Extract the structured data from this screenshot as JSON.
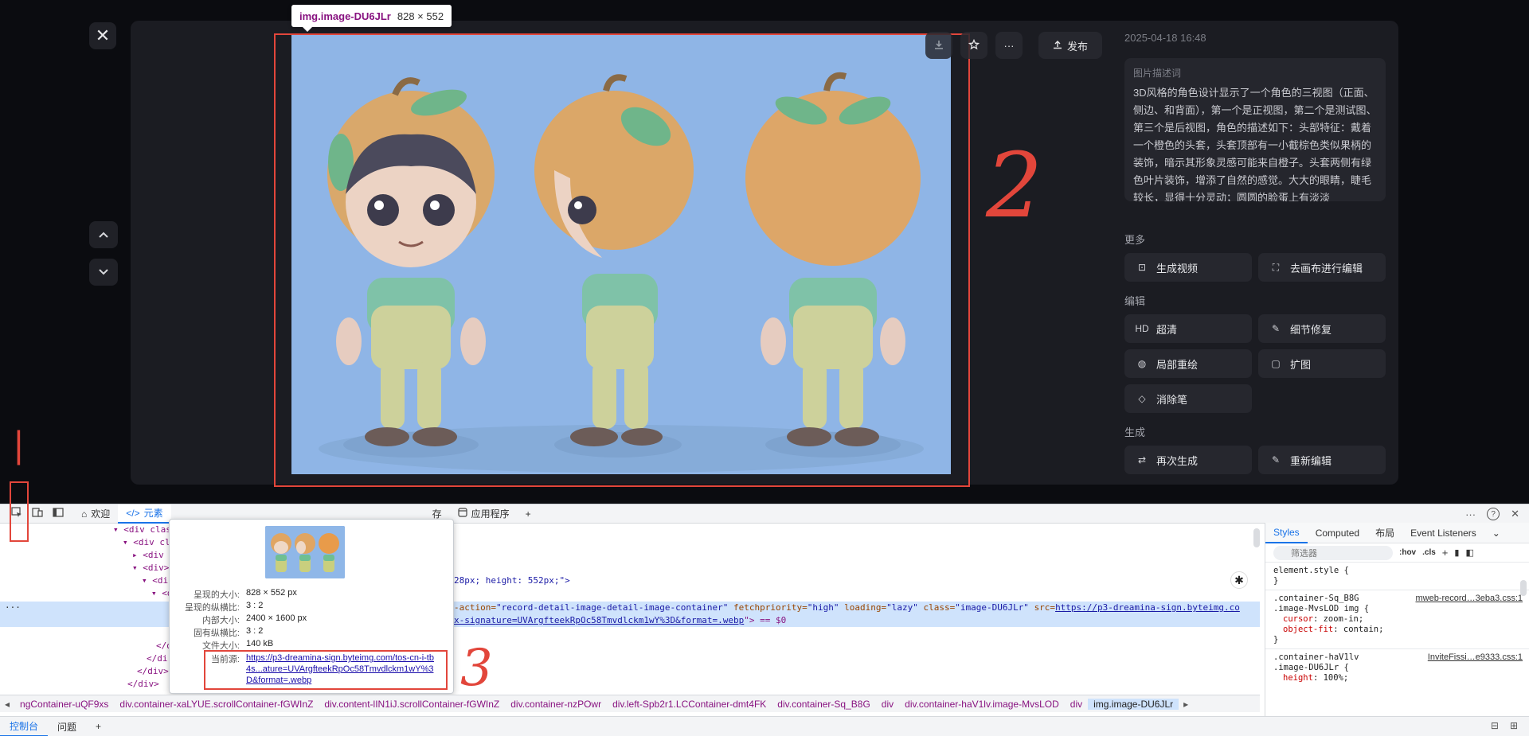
{
  "viewer": {
    "close_icon": "✕",
    "nav_up": "⌃",
    "nav_down": "⌄",
    "inspect_tag": {
      "name": "img.image-DU6JLr",
      "size": "828 × 552"
    },
    "actions": {
      "publish": "发布",
      "more": "···"
    },
    "timestamp": "2025-04-18 16:48",
    "desc_title": "图片描述词",
    "desc_text": "3D风格的角色设计显示了一个角色的三视图（正面、侧边、和背面），第一个是正视图，第二个是测试图、第三个是后视图，角色的描述如下：头部特征：戴着一个橙色的头套，头套顶部有一小截棕色类似果柄的装饰，暗示其形象灵感可能来自橙子。头套两侧有绿色叶片装饰，增添了自然的感觉。大大的眼睛，睫毛较长，显得十分灵动；圆圆的脸蛋上有淡淡",
    "sections": [
      {
        "title": "更多",
        "buttons": [
          {
            "icon": "⊡",
            "label": "生成视频"
          },
          {
            "icon": "⛶",
            "label": "去画布进行编辑"
          }
        ]
      },
      {
        "title": "编辑",
        "buttons": [
          {
            "icon": "HD",
            "label": "超清"
          },
          {
            "icon": "✎",
            "label": "细节修复"
          },
          {
            "icon": "◍",
            "label": "局部重绘"
          },
          {
            "icon": "▢",
            "label": "扩图"
          },
          {
            "icon": "◇",
            "label": "消除笔"
          }
        ]
      },
      {
        "title": "生成",
        "buttons": [
          {
            "icon": "⇄",
            "label": "再次生成"
          },
          {
            "icon": "✎",
            "label": "重新编辑"
          }
        ]
      }
    ],
    "annotations": {
      "a1": "|",
      "a2": "2",
      "a3": "3"
    }
  },
  "devtools": {
    "tabs": [
      {
        "icon": "⌂",
        "label": "欢迎"
      },
      {
        "icon": "</>",
        "label": "元素"
      }
    ],
    "tab_apps": "应用程序",
    "tab_partial": "存",
    "add": "+",
    "right_more": "···",
    "right_help": "?",
    "right_close": "✕",
    "dom": {
      "l1": "<div class",
      "l2": "<div cl",
      "l3": "<div",
      "l4": "<div>",
      "l5": "<di",
      "l6_end": "28px; height: 552px;\">",
      "sel_attr_prefix": "-action=",
      "sel_attr_value": "\"record-detail-image-detail-image-container\"",
      "sel_fetch": "fetchpriority=",
      "sel_fetch_v": "\"high\"",
      "sel_loading": "loading=",
      "sel_loading_v": "\"lazy\"",
      "sel_class": "class=",
      "sel_class_v": "\"image-DU6JLr\"",
      "sel_src": "src=",
      "sel_src_v": "https://p3-dreamina-sign.byteimg.co",
      "sel_line2": "x-signature=UVArgfteekRpOc58Tmvdlckm1wY%3D&format=.webp",
      "sel_line2_end": "\"> == $0",
      "close1": "</di",
      "close2": "</di",
      "close3": "</div>",
      "close4": "</div>"
    },
    "hover": {
      "rows": [
        {
          "k": "呈现的大小:",
          "v": "828 × 552 px"
        },
        {
          "k": "呈现的纵横比:",
          "v": "3 : 2"
        },
        {
          "k": "内部大小:",
          "v": "2400 × 1600 px"
        },
        {
          "k": "固有纵横比:",
          "v": "3 : 2"
        },
        {
          "k": "文件大小:",
          "v": "140 kB"
        }
      ],
      "src_label": "当前源:",
      "src": "https://p3-dreamina-sign.byteimg.com/tos-cn-i-tb4s...ature=UVArgfteekRpOc58Tmvdlckm1wY%3D&format=.webp"
    },
    "crumbs": [
      "ngContainer-uQF9xs",
      "div.container-xaLYUE.scrollContainer-fGWInZ",
      "div.content-lIN1iJ.scrollContainer-fGWInZ",
      "div.container-nzPOwr",
      "div.left-Spb2r1.LCContainer-dmt4FK",
      "div.container-Sq_B8G",
      "div",
      "div.container-haV1lv.image-MvsLOD",
      "div",
      "img.image-DU6JLr"
    ],
    "console_tabs": [
      "控制台",
      "问题"
    ],
    "styles": {
      "tabs": [
        "Styles",
        "Computed",
        "布局",
        "Event Listeners"
      ],
      "filter": "筛选器",
      "hov": ":hov",
      "cls": ".cls",
      "element_style": "element.style {",
      "brace": "}",
      "rule1_sel1": ".container-Sq_B8G",
      "rule1_sel2": ".image-MvsLOD img {",
      "rule1_src": "mweb-record…3eba3.css:1",
      "rule1_p1": "cursor",
      "rule1_v1": "zoom-in;",
      "rule1_p2": "object-fit",
      "rule1_v2": "contain;",
      "rule2_sel1": ".container-haV1lv",
      "rule2_sel2": ".image-DU6JLr {",
      "rule2_src": "InviteFissi…e9333.css:1",
      "rule2_p1": "height",
      "rule2_v1": "100%;"
    }
  }
}
